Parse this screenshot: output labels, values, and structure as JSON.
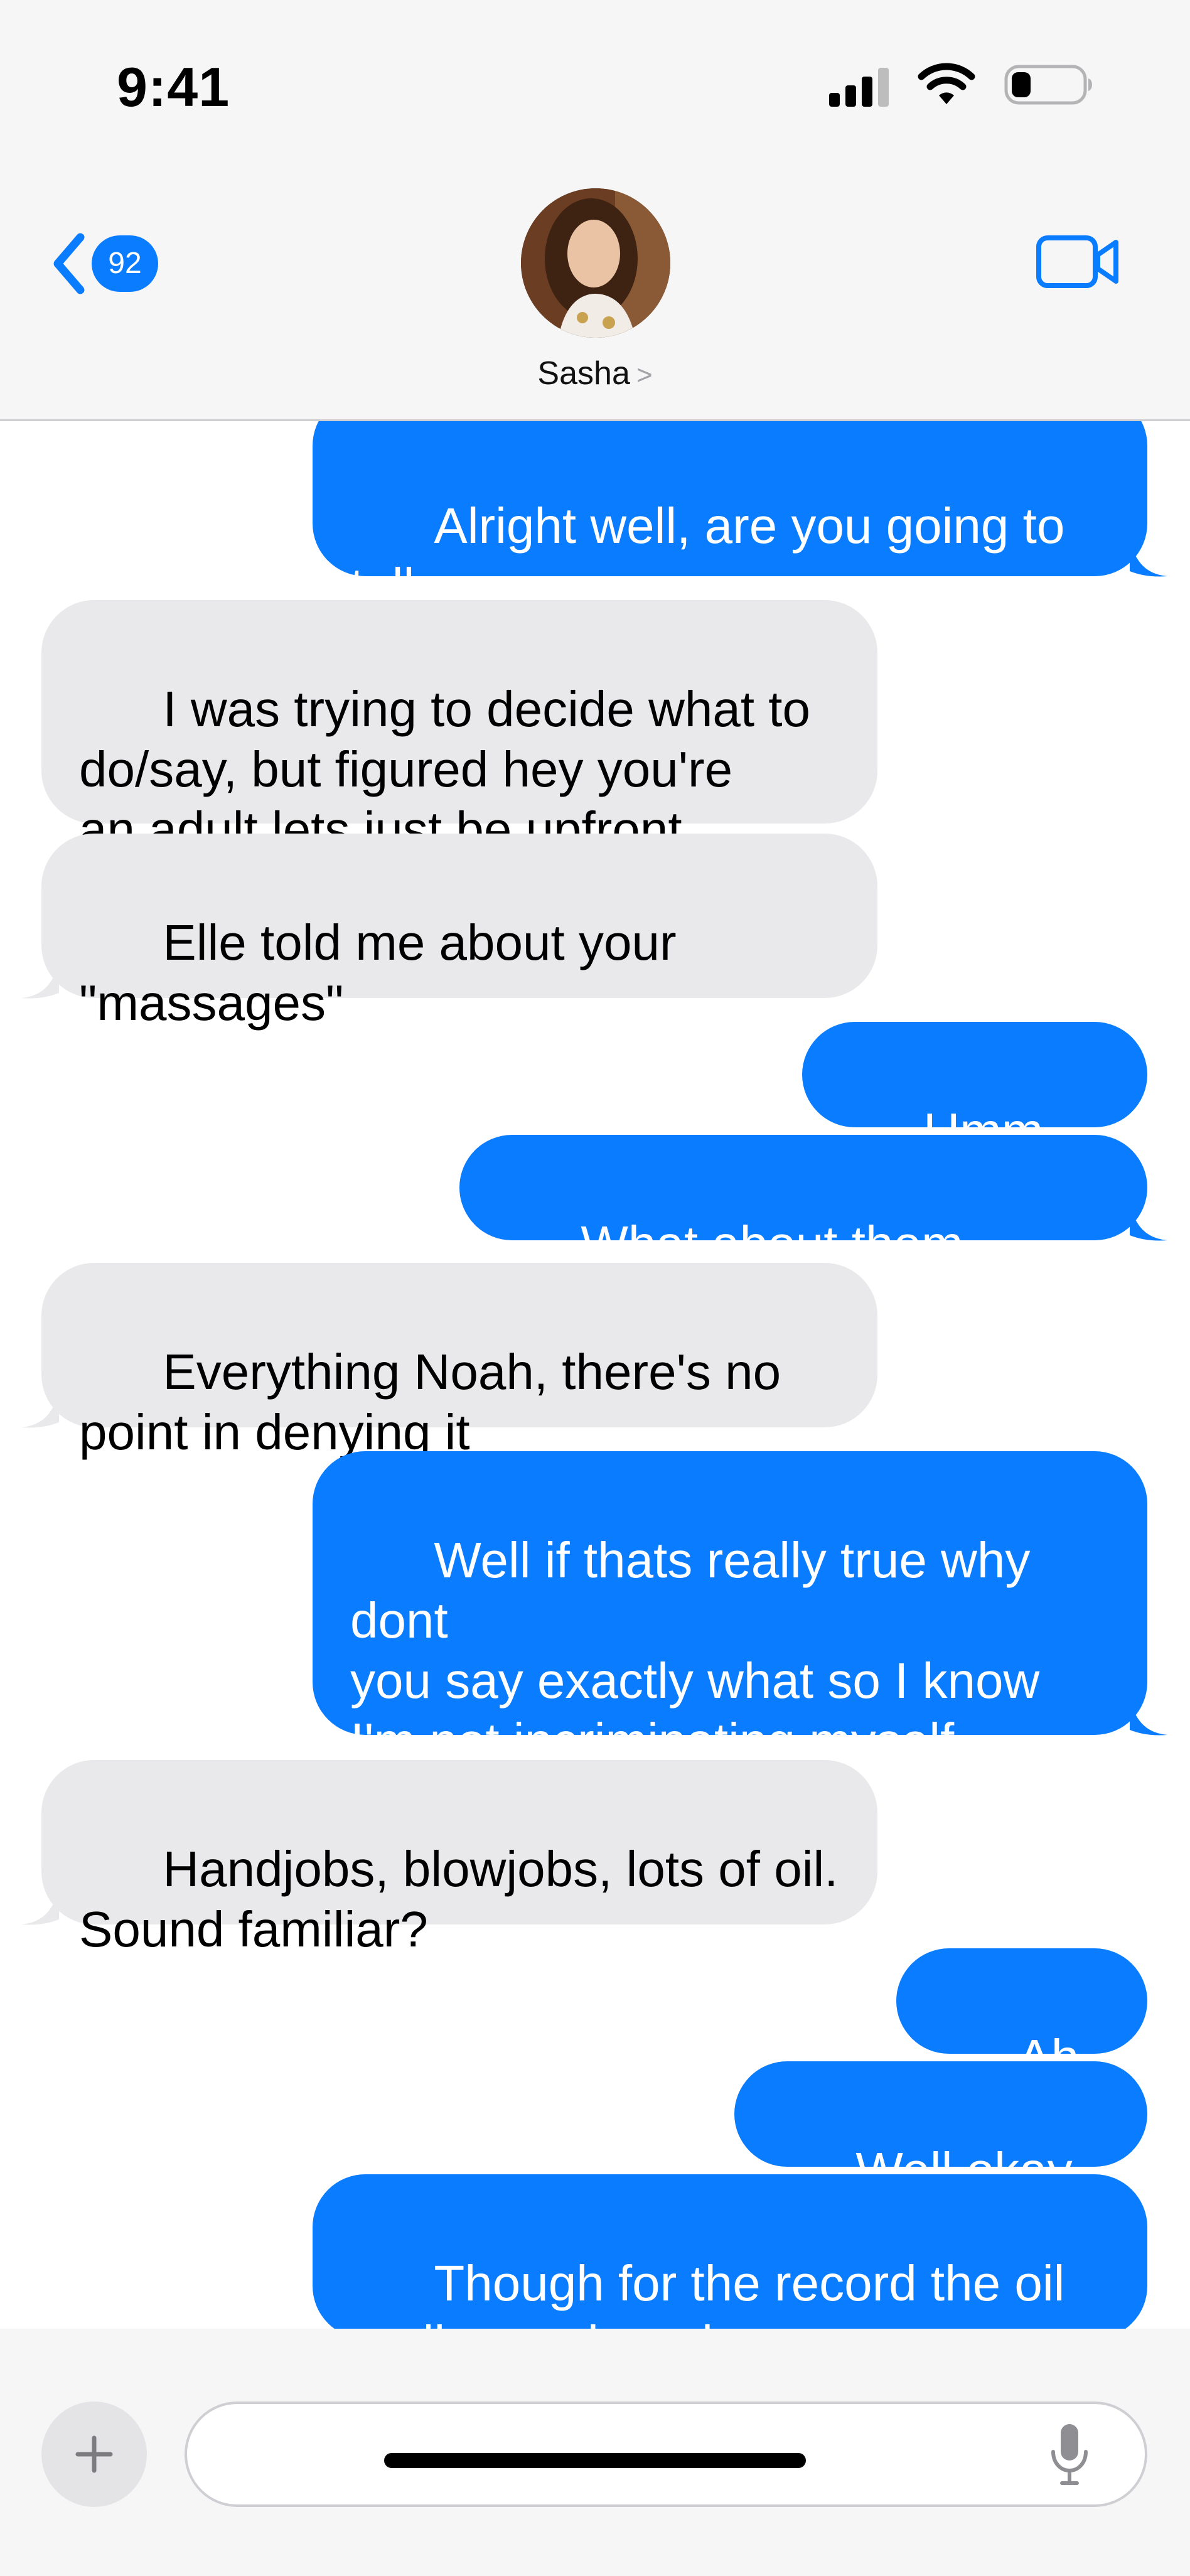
{
  "status_bar": {
    "time": "9:41",
    "icons": [
      "cellular-signal-icon",
      "wifi-icon",
      "battery-icon"
    ]
  },
  "header": {
    "back_badge": "92",
    "contact_name": "Sasha",
    "contact_chevron": ">",
    "video_icon": "video-camera-icon",
    "avatar": "contact-photo"
  },
  "colors": {
    "sent_bubble": "#0a7cff",
    "received_bubble": "#e9e9eb",
    "accent": "#0a7cff"
  },
  "messages": [
    {
      "from": "me",
      "text": "Alright well, are you going to tell\nme more or thats it?"
    },
    {
      "from": "them",
      "text": "I was trying to decide what to\ndo/say, but figured hey you're\nan adult lets just be upfront"
    },
    {
      "from": "them",
      "text": "Elle told me about your\n\"massages\""
    },
    {
      "from": "me",
      "text": "Umm okay?"
    },
    {
      "from": "me",
      "text": "What about them exactly?"
    },
    {
      "from": "them",
      "text": "Everything Noah, there's no\npoint in denying it"
    },
    {
      "from": "me",
      "text": "Well if thats really true why dont\nyou say exactly what so I know\nI'm not incriminating myself\nfurther"
    },
    {
      "from": "them",
      "text": "Handjobs, blowjobs, lots of oil.\nSound familiar?"
    },
    {
      "from": "me",
      "text": "Ah fuck"
    },
    {
      "from": "me",
      "text": "Well okay then"
    },
    {
      "from": "me",
      "text": "Though for the record the oil\nreally was harmless"
    }
  ],
  "composer": {
    "input_value": "",
    "input_placeholder": "",
    "plus_icon": "plus-icon",
    "mic_icon": "microphone-icon"
  }
}
